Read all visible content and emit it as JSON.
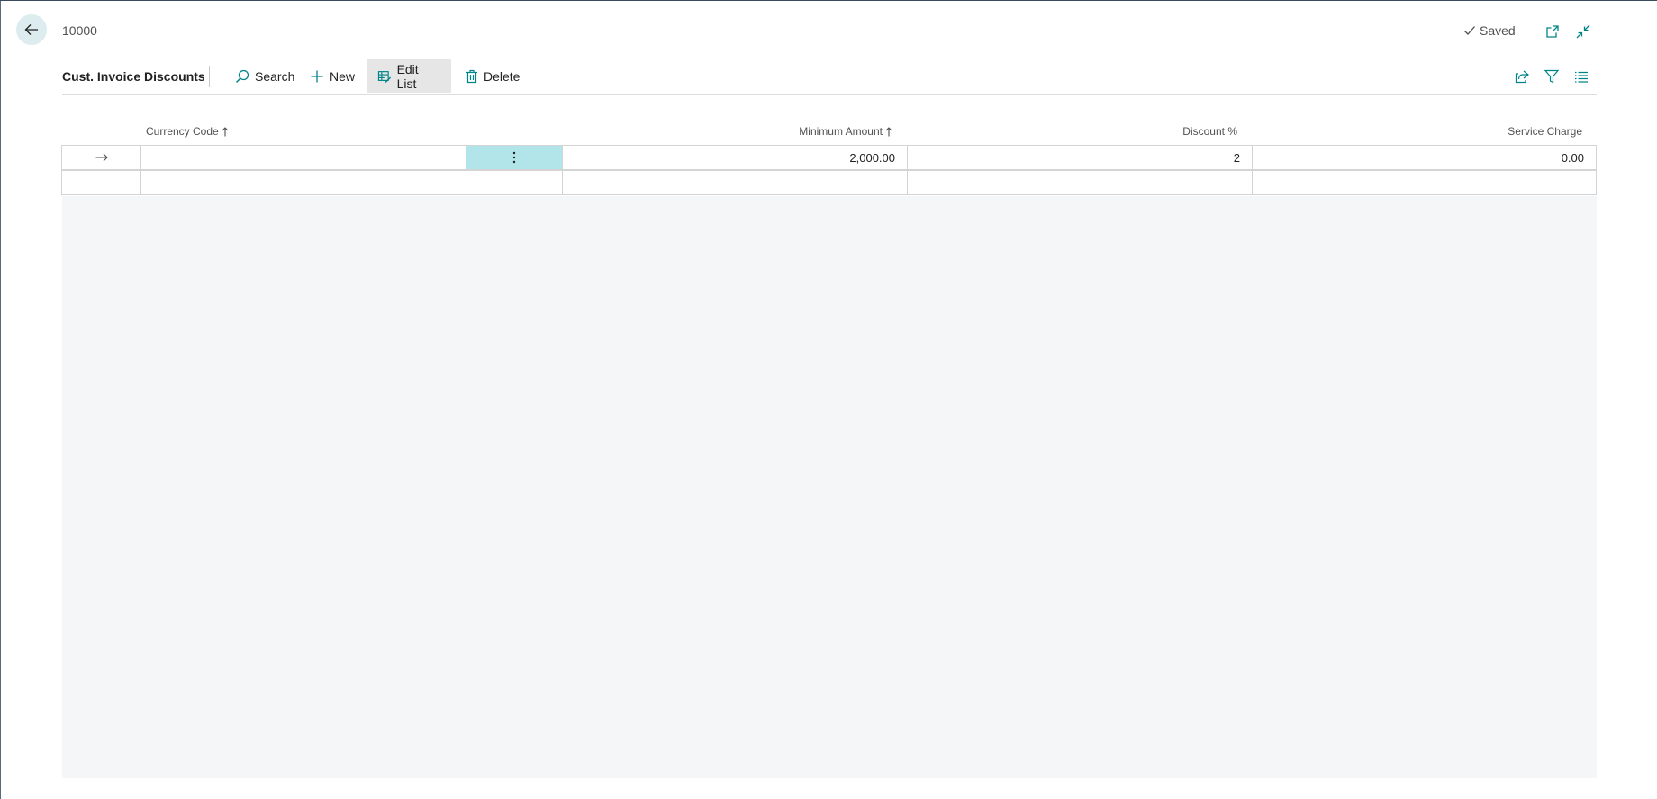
{
  "header": {
    "record_title": "10000",
    "saved_label": "Saved"
  },
  "page": {
    "caption": "Cust. Invoice Discounts"
  },
  "actions": {
    "search": "Search",
    "new": "New",
    "edit_list": "Edit List",
    "delete": "Delete"
  },
  "columns": {
    "currency_code": "Currency Code",
    "minimum_amount": "Minimum Amount",
    "discount_pct": "Discount %",
    "service_charge": "Service Charge"
  },
  "rows": [
    {
      "currency_code": "",
      "minimum_amount": "2,000.00",
      "discount_pct": "2",
      "service_charge": "0.00",
      "current": true
    },
    {
      "currency_code": "",
      "minimum_amount": "",
      "discount_pct": "",
      "service_charge": "",
      "current": false
    }
  ],
  "icons": {
    "back": "arrow-left-icon",
    "saved": "checkmark-icon",
    "open_new_window": "open-in-new-window-icon",
    "collapse": "collapse-icon",
    "search": "search-icon",
    "new": "plus-icon",
    "edit_list": "edit-list-icon",
    "delete": "trash-icon",
    "share": "share-icon",
    "filter": "filter-icon",
    "list_view": "list-view-icon",
    "row_pointer": "arrow-right-icon",
    "row_menu": "ellipsis-vertical-icon"
  },
  "colors": {
    "accent": "#008489",
    "selected_cell": "#b1e5ea",
    "empty_area": "#f5f6f7"
  }
}
